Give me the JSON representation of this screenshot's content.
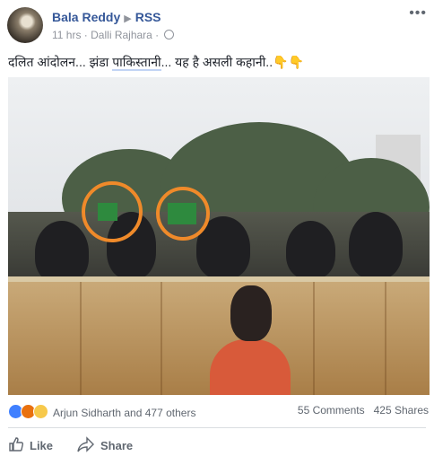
{
  "post": {
    "author": "Bala Reddy",
    "target": "RSS",
    "time": "11 hrs",
    "location": "Dalli Rajhara",
    "text_prefix": "दलित आंदोलन... झंडा ",
    "text_highlight": "पाकिस्तानी",
    "text_suffix": "... यह है असली कहानी..",
    "emojis": "👇👇"
  },
  "footer": {
    "reactors": "Arjun Sidharth and 477 others",
    "comments": "55 Comments",
    "shares": "425 Shares"
  },
  "actions": {
    "like_label": "Like",
    "share_label": "Share"
  },
  "icons": [
    "avatar",
    "triangle-right-icon",
    "globe-icon",
    "more-icon",
    "like-reaction-icon",
    "angry-reaction-icon",
    "sad-reaction-icon",
    "thumbs-up-icon",
    "share-icon"
  ]
}
